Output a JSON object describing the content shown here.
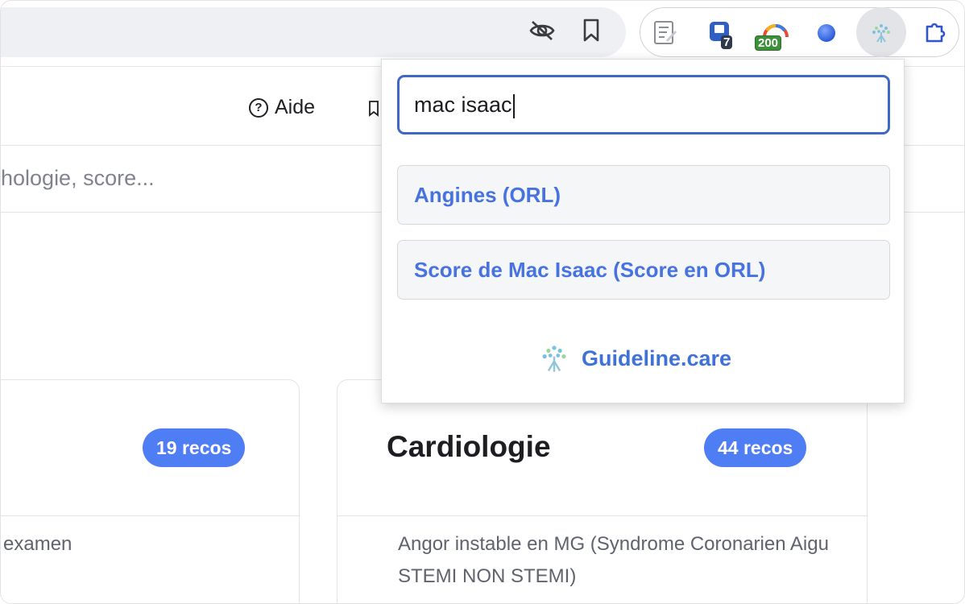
{
  "toolbar": {
    "extensions": [
      {
        "icon": "notepad-icon"
      },
      {
        "icon": "bookmark-counter-icon",
        "badge": "7",
        "badge_color": "#2f3a4a"
      },
      {
        "icon": "gauge-icon",
        "badge": "200",
        "badge_color": "#3d8f3a"
      },
      {
        "icon": "blue-dot-icon"
      },
      {
        "icon": "guideline-tree-icon",
        "active": true
      },
      {
        "icon": "puzzle-icon"
      }
    ]
  },
  "page": {
    "help_label": "Aide",
    "search_placeholder_visible": "hologie, score...",
    "cards": [
      {
        "title": "",
        "count": "19 recos",
        "first_item": "examen"
      },
      {
        "title": "Cardiologie",
        "count": "44 recos",
        "first_item": "Angor instable en MG (Syndrome Coronarien Aigu STEMI NON STEMI)"
      }
    ]
  },
  "popup": {
    "query": "mac isaac",
    "results": [
      {
        "label": "Angines (ORL)"
      },
      {
        "label": "Score de Mac Isaac (Score en ORL)"
      }
    ],
    "brand": "Guideline.care"
  },
  "colors": {
    "accent": "#4f7df3",
    "link": "#4673df",
    "input_border": "#3f68c4"
  }
}
